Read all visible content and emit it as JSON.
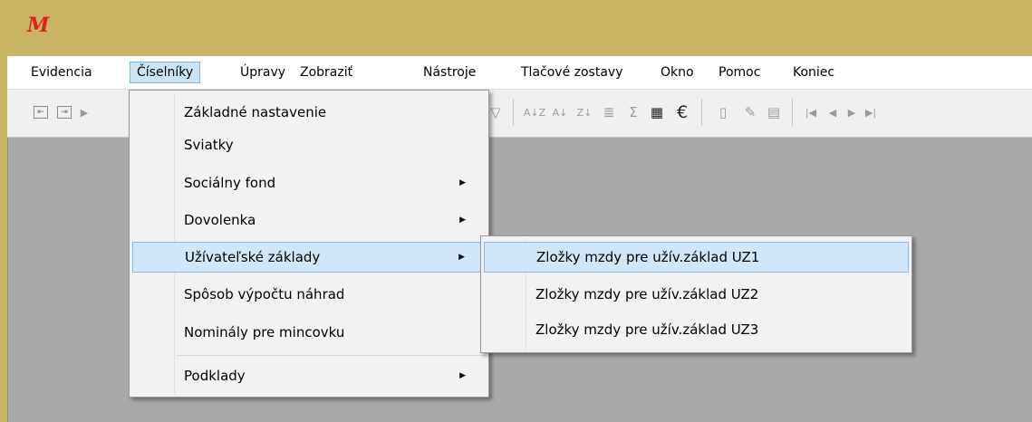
{
  "app": {
    "logo": "M"
  },
  "menubar": {
    "items": [
      {
        "label": "Evidencia"
      },
      {
        "label": "Číselníky"
      },
      {
        "label": "Úpravy"
      },
      {
        "label": "Zobraziť"
      },
      {
        "label": "Nástroje"
      },
      {
        "label": "Tlačové zostavy"
      },
      {
        "label": "Okno"
      },
      {
        "label": "Pomoc"
      },
      {
        "label": "Koniec"
      }
    ],
    "active": "Číselníky"
  },
  "toolbar": {
    "icons": [
      "back-icon",
      "forward-icon",
      "play-icon",
      "filter-icon",
      "sort-az-icon",
      "sort-az-down-icon",
      "sort-za-icon",
      "columns-icon",
      "sigma-icon",
      "calculator-icon",
      "euro-icon",
      "document-icon",
      "edit-icon",
      "properties-icon",
      "first-record-icon",
      "prev-record-icon",
      "next-record-icon",
      "last-record-icon"
    ]
  },
  "menu_ciselniky": {
    "items": [
      {
        "label": "Základné nastavenie",
        "submenu": false
      },
      {
        "label": "Sviatky",
        "submenu": false
      },
      {
        "label": "Sociálny fond",
        "submenu": true
      },
      {
        "label": "Dovolenka",
        "submenu": true
      },
      {
        "label": "Užívateľské základy",
        "submenu": true,
        "highlighted": true
      },
      {
        "label": "Spôsob výpočtu náhrad",
        "submenu": false
      },
      {
        "label": "Nominály pre mincovku",
        "submenu": false
      },
      {
        "label": "Podklady",
        "submenu": true
      }
    ]
  },
  "submenu_uzivatelske": {
    "items": [
      {
        "label": "Zložky mzdy pre užív.základ UZ1",
        "highlighted": true
      },
      {
        "label": "Zložky mzdy pre užív.základ UZ2"
      },
      {
        "label": "Zložky mzdy pre užív.základ UZ3"
      }
    ]
  },
  "colors": {
    "titlebar": "#c8b462",
    "workspace": "#a9a9a9",
    "highlight": "#d1e6f8",
    "logo": "#e0201a"
  }
}
